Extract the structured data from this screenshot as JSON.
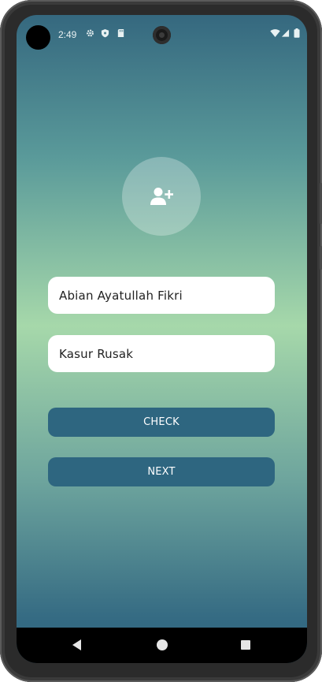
{
  "status_bar": {
    "time": "2:49",
    "icons": [
      "gear-icon",
      "shield-icon",
      "sd-card-icon",
      "wifi-icon",
      "signal-icon",
      "battery-icon"
    ]
  },
  "avatar": {
    "icon": "add-person-icon"
  },
  "form": {
    "name_value": "Abian Ayatullah Fikri",
    "second_value": "Kasur Rusak"
  },
  "buttons": {
    "check_label": "CHECK",
    "next_label": "NEXT"
  },
  "nav_bar": {
    "icons": [
      "back-icon",
      "home-icon",
      "recents-icon"
    ]
  },
  "colors": {
    "button_bg": "#2e6680",
    "gradient_top": "#35687f",
    "gradient_mid": "#a6d8aa",
    "gradient_bottom": "#2f6680"
  }
}
